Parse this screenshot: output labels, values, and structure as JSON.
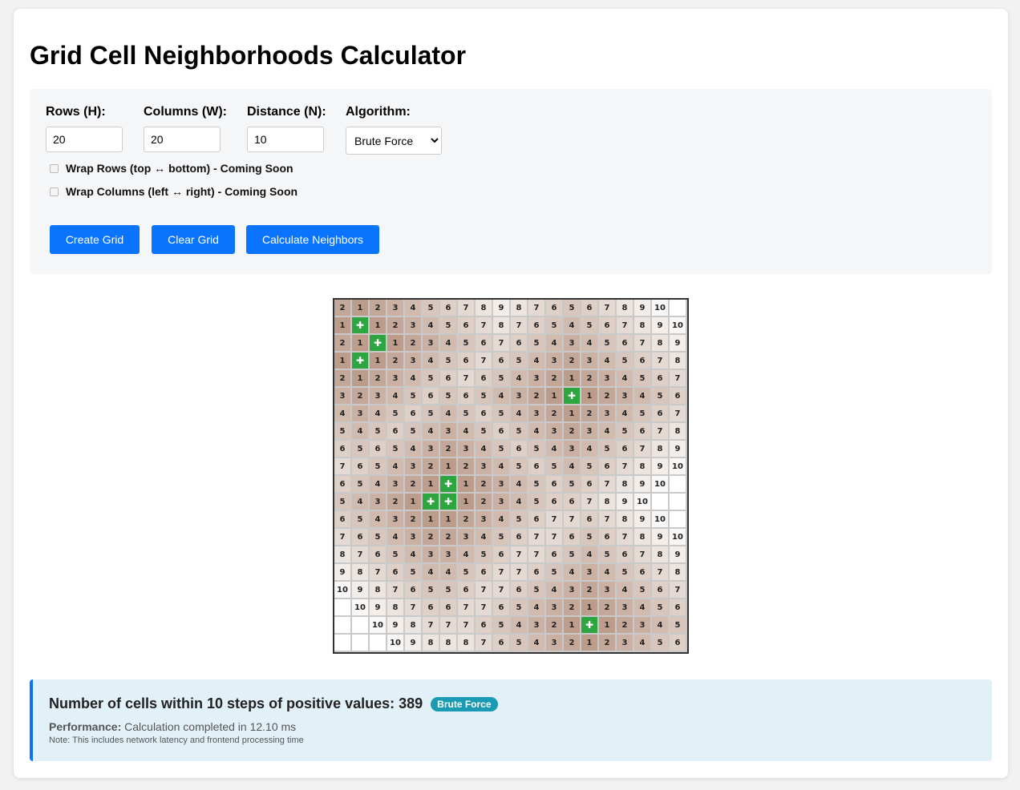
{
  "title": "Grid Cell Neighborhoods Calculator",
  "controls": {
    "rows_label": "Rows (H):",
    "rows_value": "20",
    "cols_label": "Columns (W):",
    "cols_value": "20",
    "distance_label": "Distance (N):",
    "distance_value": "10",
    "algorithm_label": "Algorithm:",
    "algorithm_value": "Brute Force",
    "wrap_rows_label": "Wrap Rows (top ↔ bottom) - Coming Soon",
    "wrap_cols_label": "Wrap Columns (left ↔ right) - Coming Soon",
    "create_label": "Create Grid",
    "clear_label": "Clear Grid",
    "calculate_label": "Calculate Neighbors"
  },
  "grid": {
    "positive_symbol": "✚",
    "rows": [
      [
        "2",
        "1",
        "2",
        "3",
        "4",
        "5",
        "6",
        "7",
        "8",
        "9",
        "8",
        "7",
        "6",
        "5",
        "6",
        "7",
        "8",
        "9",
        "10",
        ""
      ],
      [
        "1",
        "+",
        "1",
        "2",
        "3",
        "4",
        "5",
        "6",
        "7",
        "8",
        "7",
        "6",
        "5",
        "4",
        "5",
        "6",
        "7",
        "8",
        "9",
        "10"
      ],
      [
        "2",
        "1",
        "+",
        "1",
        "2",
        "3",
        "4",
        "5",
        "6",
        "7",
        "6",
        "5",
        "4",
        "3",
        "4",
        "5",
        "6",
        "7",
        "8",
        "9"
      ],
      [
        "1",
        "+",
        "1",
        "2",
        "3",
        "4",
        "5",
        "6",
        "7",
        "6",
        "5",
        "4",
        "3",
        "2",
        "3",
        "4",
        "5",
        "6",
        "7",
        "8"
      ],
      [
        "2",
        "1",
        "2",
        "3",
        "4",
        "5",
        "6",
        "7",
        "6",
        "5",
        "4",
        "3",
        "2",
        "1",
        "2",
        "3",
        "4",
        "5",
        "6",
        "7"
      ],
      [
        "3",
        "2",
        "3",
        "4",
        "5",
        "6",
        "5",
        "6",
        "5",
        "4",
        "3",
        "2",
        "1",
        "+",
        "1",
        "2",
        "3",
        "4",
        "5",
        "6"
      ],
      [
        "4",
        "3",
        "4",
        "5",
        "6",
        "5",
        "4",
        "5",
        "6",
        "5",
        "4",
        "3",
        "2",
        "1",
        "2",
        "3",
        "4",
        "5",
        "6",
        "7"
      ],
      [
        "5",
        "4",
        "5",
        "6",
        "5",
        "4",
        "3",
        "4",
        "5",
        "6",
        "5",
        "4",
        "3",
        "2",
        "3",
        "4",
        "5",
        "6",
        "7",
        "8"
      ],
      [
        "6",
        "5",
        "6",
        "5",
        "4",
        "3",
        "2",
        "3",
        "4",
        "5",
        "6",
        "5",
        "4",
        "3",
        "4",
        "5",
        "6",
        "7",
        "8",
        "9"
      ],
      [
        "7",
        "6",
        "5",
        "4",
        "3",
        "2",
        "1",
        "2",
        "3",
        "4",
        "5",
        "6",
        "5",
        "4",
        "5",
        "6",
        "7",
        "8",
        "9",
        "10"
      ],
      [
        "6",
        "5",
        "4",
        "3",
        "2",
        "1",
        "+",
        "1",
        "2",
        "3",
        "4",
        "5",
        "6",
        "5",
        "6",
        "7",
        "8",
        "9",
        "10",
        ""
      ],
      [
        "5",
        "4",
        "3",
        "2",
        "1",
        "+",
        "+",
        "1",
        "2",
        "3",
        "4",
        "5",
        "6",
        "6",
        "7",
        "8",
        "9",
        "10",
        "",
        ""
      ],
      [
        "6",
        "5",
        "4",
        "3",
        "2",
        "1",
        "1",
        "2",
        "3",
        "4",
        "5",
        "6",
        "7",
        "7",
        "6",
        "7",
        "8",
        "9",
        "10",
        ""
      ],
      [
        "7",
        "6",
        "5",
        "4",
        "3",
        "2",
        "2",
        "3",
        "4",
        "5",
        "6",
        "7",
        "7",
        "6",
        "5",
        "6",
        "7",
        "8",
        "9",
        "10"
      ],
      [
        "8",
        "7",
        "6",
        "5",
        "4",
        "3",
        "3",
        "4",
        "5",
        "6",
        "7",
        "7",
        "6",
        "5",
        "4",
        "5",
        "6",
        "7",
        "8",
        "9"
      ],
      [
        "9",
        "8",
        "7",
        "6",
        "5",
        "4",
        "4",
        "5",
        "6",
        "7",
        "7",
        "6",
        "5",
        "4",
        "3",
        "4",
        "5",
        "6",
        "7",
        "8"
      ],
      [
        "10",
        "9",
        "8",
        "7",
        "6",
        "5",
        "5",
        "6",
        "7",
        "7",
        "6",
        "5",
        "4",
        "3",
        "2",
        "3",
        "4",
        "5",
        "6",
        "7"
      ],
      [
        "",
        "10",
        "9",
        "8",
        "7",
        "6",
        "6",
        "7",
        "7",
        "6",
        "5",
        "4",
        "3",
        "2",
        "1",
        "2",
        "3",
        "4",
        "5",
        "6"
      ],
      [
        "",
        "",
        "10",
        "9",
        "8",
        "7",
        "7",
        "7",
        "6",
        "5",
        "4",
        "3",
        "2",
        "1",
        "+",
        "1",
        "2",
        "3",
        "4",
        "5"
      ],
      [
        "",
        "",
        "",
        "10",
        "9",
        "8",
        "8",
        "8",
        "7",
        "6",
        "5",
        "4",
        "3",
        "2",
        "1",
        "2",
        "3",
        "4",
        "5",
        "6"
      ]
    ]
  },
  "result": {
    "summary": "Number of cells within 10 steps of positive values: 389",
    "badge": "Brute Force",
    "perf_label": "Performance:",
    "perf_text": "Calculation completed in 12.10 ms",
    "note": "Note: This includes network latency and frontend processing time"
  },
  "colors": {
    "accent": "#0a74ff",
    "positive": "#2ea63f",
    "badge": "#1a9ab3",
    "result_bg": "#e2f0f8"
  }
}
